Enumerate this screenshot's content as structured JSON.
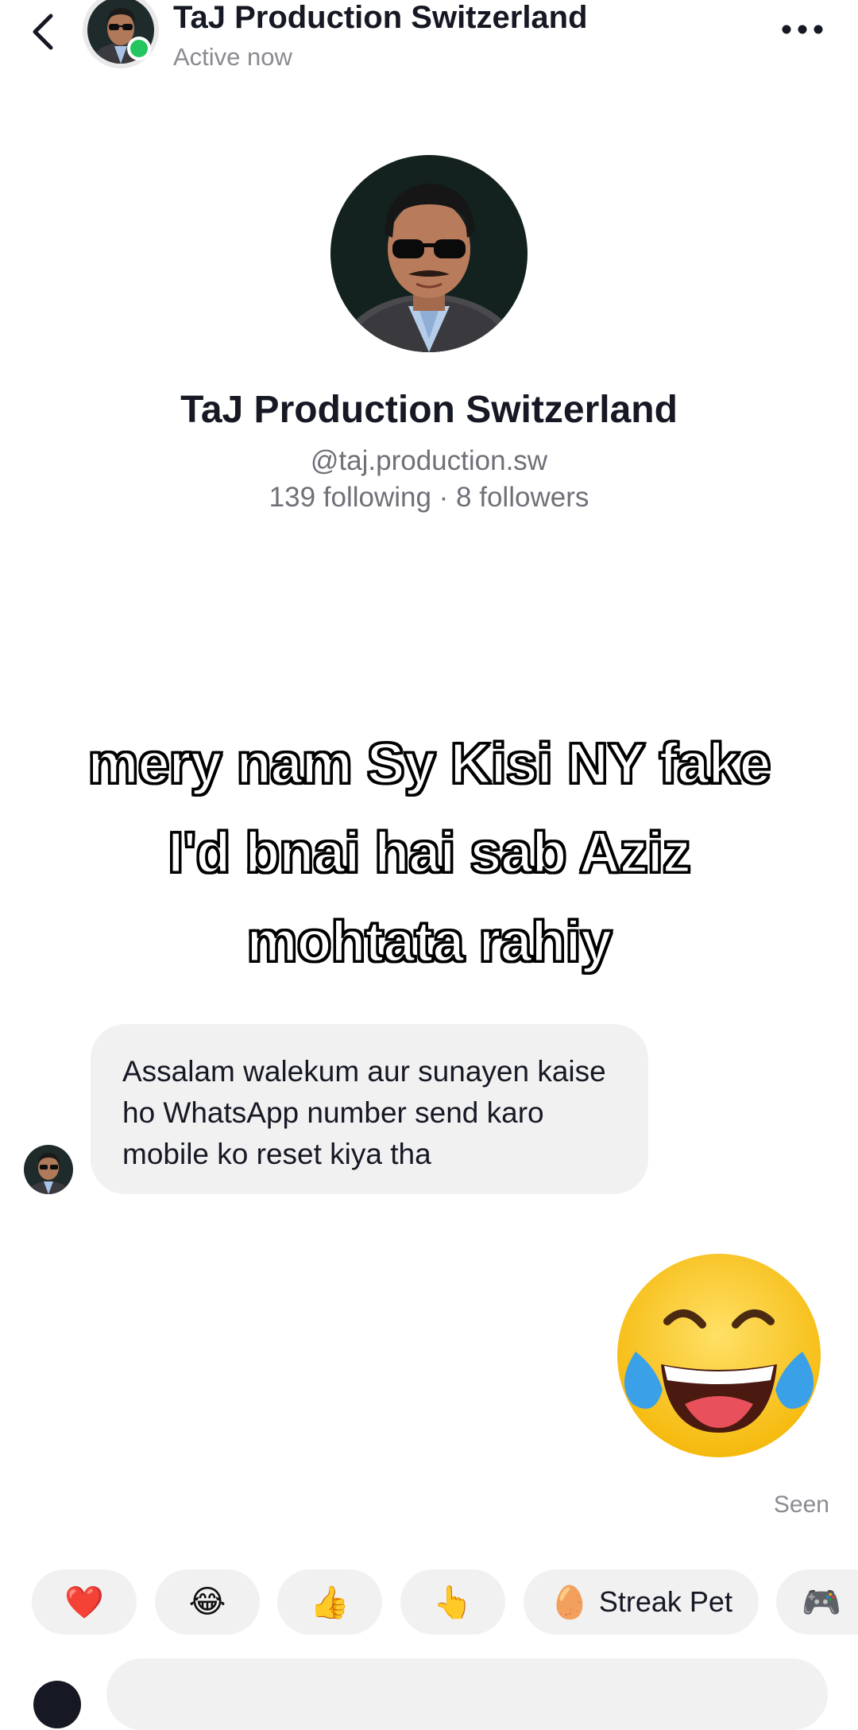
{
  "header": {
    "name": "TaJ Production Switzerland",
    "status": "Active now"
  },
  "profile": {
    "name": "TaJ Production Switzerland",
    "handle": "@taj.production.sw",
    "stats": "139 following · 8 followers"
  },
  "overlay": {
    "line1": "mery nam Sy Kisi NY fake",
    "line2": "I'd bnai hai sab Aziz",
    "line3": "mohtata rahiy"
  },
  "messages": {
    "incoming_text": "Assalam walekum aur sunayen kaise ho WhatsApp number send karo mobile ko reset kiya tha",
    "outgoing_emoji": "😂",
    "seen_label": "Seen"
  },
  "quick_reactions": [
    {
      "icon": "heart-icon",
      "glyph": "❤️",
      "label": ""
    },
    {
      "icon": "laughing-tears-icon",
      "glyph": "😂",
      "label": ""
    },
    {
      "icon": "thumbs-up-icon",
      "glyph": "👍",
      "label": ""
    },
    {
      "icon": "pointing-hand-icon",
      "glyph": "👆",
      "label": ""
    },
    {
      "icon": "egg-icon",
      "glyph": "🥚",
      "label": "Streak Pet"
    },
    {
      "icon": "game-controller-icon",
      "glyph": "🎮",
      "label": ""
    }
  ],
  "colors": {
    "online": "#22c55e",
    "bubble": "#f1f1f2",
    "muted_text": "#8a8b91"
  }
}
